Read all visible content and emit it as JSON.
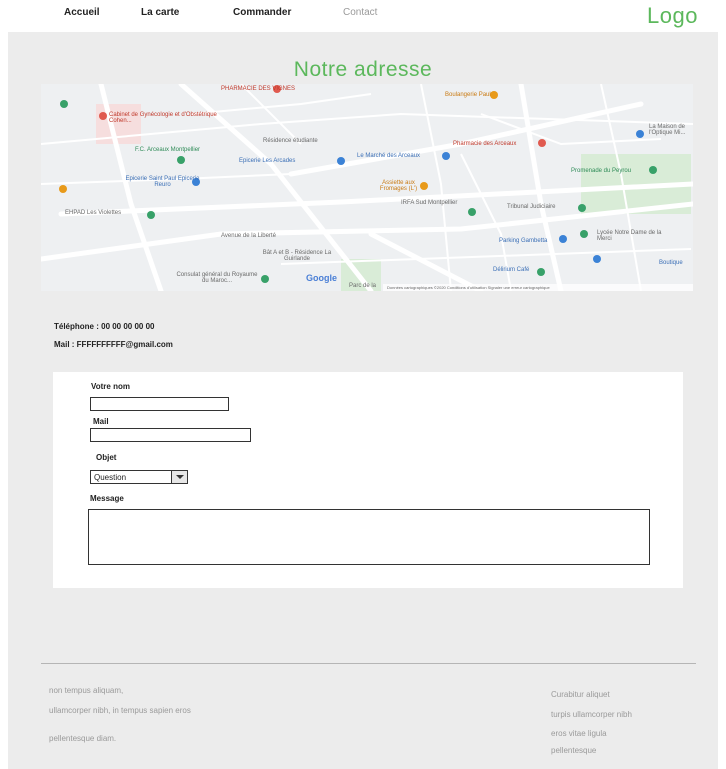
{
  "nav": {
    "items": [
      "Accueil",
      "La carte",
      "Commander",
      "Contact"
    ],
    "logo": "Logo"
  },
  "page": {
    "title": "Notre adresse",
    "phone": "Téléphone : 00 00 00 00 00",
    "mail": "Mail : FFFFFFFFFF@gmail.com"
  },
  "map": {
    "labels": [
      "PHARMACIE DES VIGNES",
      "Boulangerie Paul",
      "Cabinet de Gynécologie et d'Obstétrique Cohen...",
      "Résidence étudiante",
      "Pharmacie des Arceaux",
      "F.C. Arceaux Montpellier",
      "Epicerie Les Arcades",
      "Le Marché des Arceaux",
      "Epicerie Saint Paul Epicerie Reuro",
      "Assiette aux Fromages (L')",
      "Promenade du Peyrou",
      "EHPAD Les Violettes",
      "IRFA Sud Montpellier",
      "Tribunal Judiciaire",
      "Avenue de la Liberté",
      "Lycée Notre Dame de la Merci",
      "Parking Gambetta",
      "Bât A et B - Résidence La Guirlande",
      "Délirium Café",
      "Consulat général du Royaume du Maroc...",
      "Boutique",
      "La Maison de l'Optique Mi...",
      "Parc de la"
    ],
    "google": "Google",
    "footer": "Données cartographiques ©2020   Conditions d'utilisation   Signaler une erreur cartographique"
  },
  "form": {
    "name_label": "Votre nom",
    "mail_label": "Mail",
    "subject_label": "Objet",
    "subject_value": "Question",
    "message_label": "Message"
  },
  "footer": {
    "left": [
      "non tempus aliquam,",
      "ullamcorper nibh, in tempus sapien eros",
      "pellentesque diam."
    ],
    "right": [
      "Curabitur aliquet",
      "turpis ullamcorper nibh",
      "eros vitae ligula",
      "pellentesque"
    ]
  },
  "colors": {
    "accent": "#5cb85c",
    "section_bg": "#ececec"
  }
}
